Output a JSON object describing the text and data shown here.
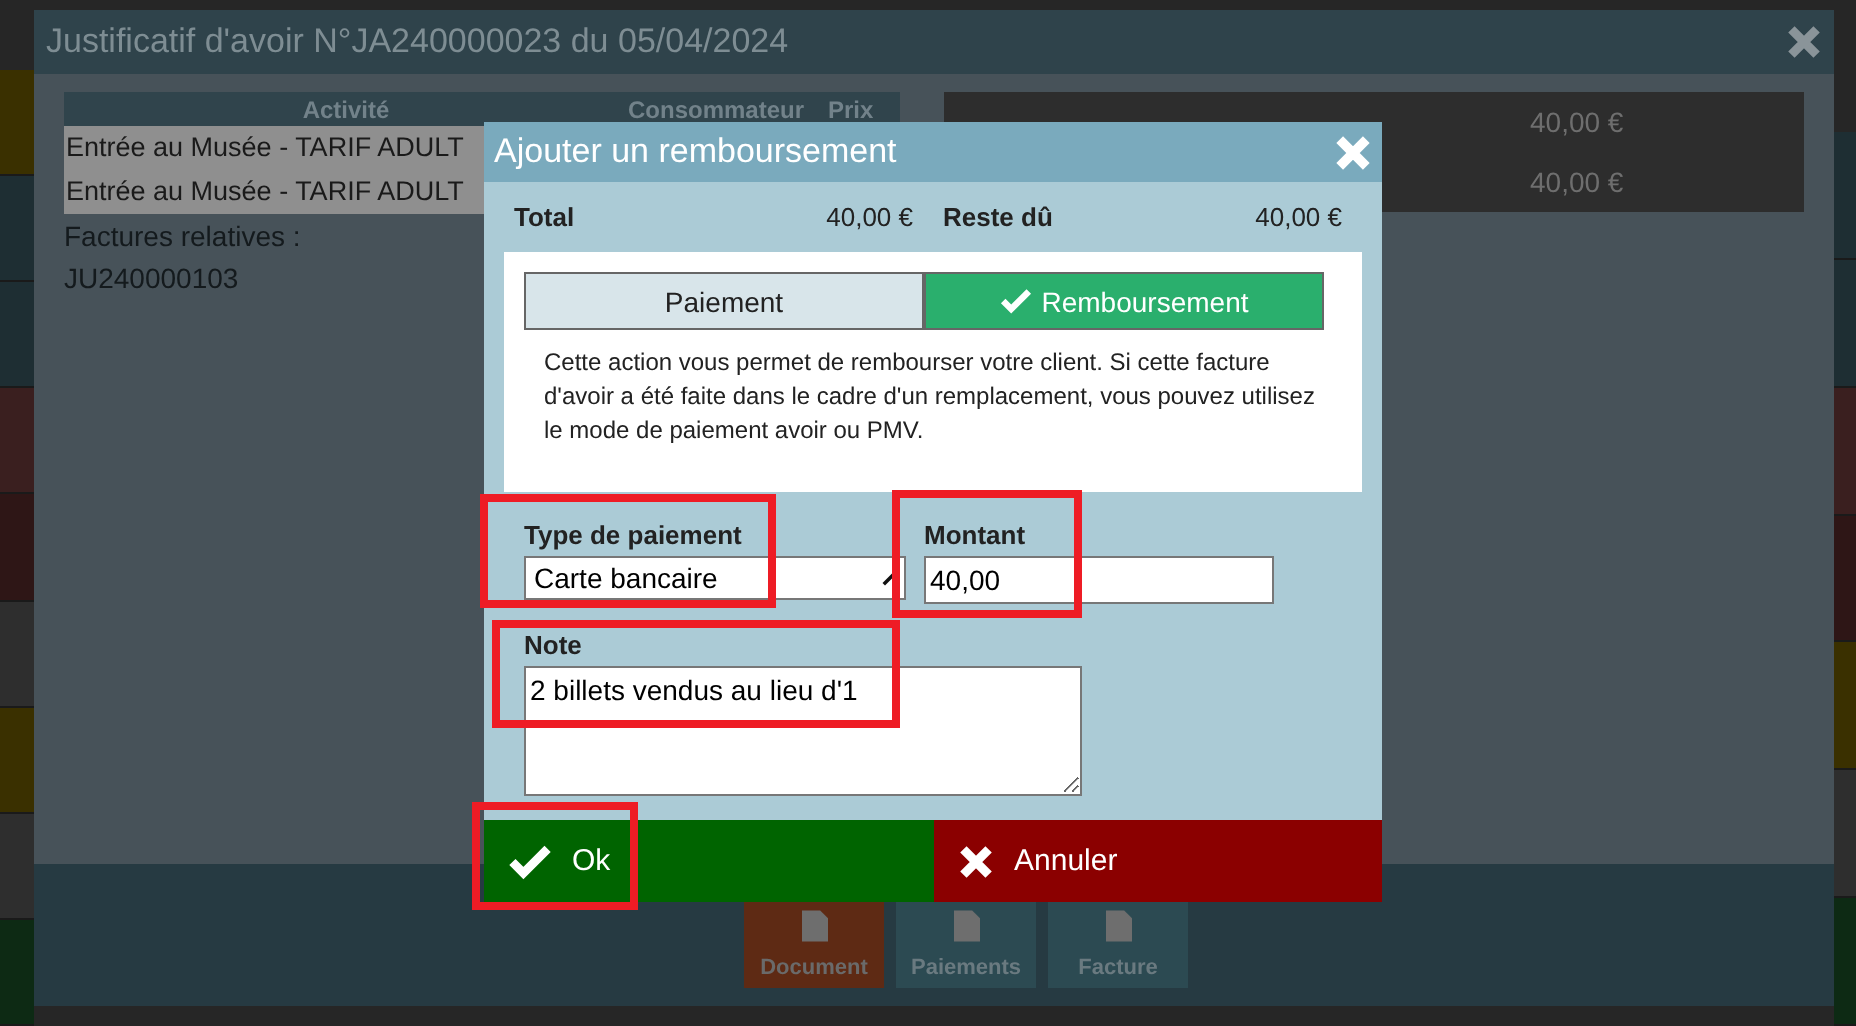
{
  "background_dialog": {
    "title": "Justificatif d'avoir N°JA240000023 du 05/04/2024",
    "table": {
      "columns": [
        "Activité",
        "Consommateur",
        "Prix"
      ],
      "rows": [
        {
          "activity": "Entrée au Musée - TARIF ADULT"
        },
        {
          "activity": "Entrée au Musée - TARIF ADULT"
        }
      ]
    },
    "related_label": "Factures relatives :",
    "related_invoice": "JU240000103",
    "summary": [
      {
        "amount": "40,00 €"
      },
      {
        "amount": "40,00 €"
      }
    ],
    "tiles": [
      {
        "label": "Document",
        "selected": true
      },
      {
        "label": "Paiements",
        "selected": false
      },
      {
        "label": "Facture",
        "selected": false
      }
    ]
  },
  "modal": {
    "title": "Ajouter un remboursement",
    "totals": [
      {
        "label": "Total",
        "amount": "40,00 €"
      },
      {
        "label": "Reste dû",
        "amount": "40,00 €"
      }
    ],
    "tabs": [
      {
        "label": "Paiement",
        "selected": false
      },
      {
        "label": "Remboursement",
        "selected": true
      }
    ],
    "description": "Cette action vous permet de rembourser votre client. Si cette facture d'avoir a été faite dans le cadre d'un remplacement, vous pouvez utilisez le mode de paiement avoir ou PMV.",
    "payment_type": {
      "label": "Type de paiement",
      "value": "Carte bancaire"
    },
    "amount": {
      "label": "Montant",
      "value": "40,00"
    },
    "note": {
      "label": "Note",
      "value": "2 billets vendus au lieu d'1"
    },
    "buttons": [
      {
        "kind": "ok",
        "label": "Ok"
      },
      {
        "kind": "cancel",
        "label": "Annuler"
      }
    ]
  }
}
